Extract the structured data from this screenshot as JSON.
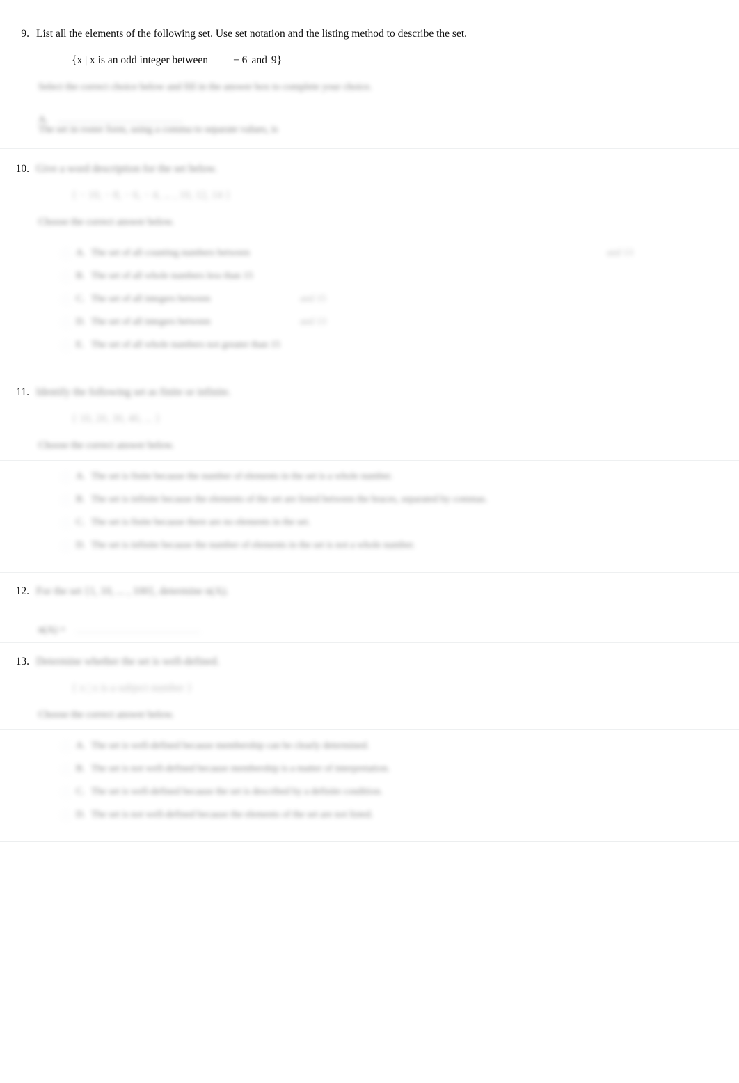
{
  "document": {
    "type": "math-worksheet",
    "page_background": "#ffffff",
    "divider_color": "#eef0f1",
    "questions": [
      {
        "number": "9.",
        "legible": true,
        "text": "List all the elements of the following set. Use set notation and the listing method to describe the set.",
        "set_expression_prefix": "{x | x is an odd integer between",
        "set_expression_value_a": "− 6",
        "set_expression_and": "and",
        "set_expression_value_b": "9",
        "set_expression_suffix": "}",
        "prompt": "Select the correct choice below and fill in the answer box to complete your choice.",
        "answer_label": "A.",
        "sub_prompt": "The set in roster form, using a comma to separate values, is",
        "blank": ""
      },
      {
        "number": "10.",
        "legible": false,
        "text": "Give a word description for the set below.",
        "set_expression": "{ − 10, − 8, − 6, − 4, ... , 10, 12, 14 }",
        "prompt": "Choose the correct answer below.",
        "choices": [
          {
            "letter": "A.",
            "text": "The set of all counting numbers between",
            "tail": "and 13"
          },
          {
            "letter": "B.",
            "text": "The set of all whole numbers less than 15"
          },
          {
            "letter": "C.",
            "text": "The set of all integers between",
            "tail": "and 15"
          },
          {
            "letter": "D.",
            "text": "The set of all integers between",
            "tail": "and 13"
          },
          {
            "letter": "E.",
            "text": "The set of all whole numbers not greater than 15"
          }
        ]
      },
      {
        "number": "11.",
        "legible": false,
        "text": "Identify the following set as finite or infinite.",
        "set_expression": "{ 10, 20, 30, 40, ... }",
        "prompt": "Choose the correct answer below.",
        "choices": [
          {
            "letter": "A.",
            "text": "The set is finite because the number of elements in the set is a whole number."
          },
          {
            "letter": "B.",
            "text": "The set is infinite because the elements of the set are listed between the braces, separated by commas."
          },
          {
            "letter": "C.",
            "text": "The set is finite because there are no elements in the set."
          },
          {
            "letter": "D.",
            "text": "The set is infinite because the number of elements in the set is not a whole number."
          }
        ]
      },
      {
        "number": "12.",
        "legible": false,
        "text": "For the set {1, 10, ... , 100}, determine n(A).",
        "answer_label": "n(A) =",
        "answer_value": ""
      },
      {
        "number": "13.",
        "legible": false,
        "text": "Determine whether the set is well-defined.",
        "set_expression": "{ x | x is a subject number }",
        "prompt": "Choose the correct answer below.",
        "choices": [
          {
            "letter": "A.",
            "text": "The set is well-defined because membership can be clearly determined."
          },
          {
            "letter": "B.",
            "text": "The set is not well-defined because membership is a matter of interpretation."
          },
          {
            "letter": "C.",
            "text": "The set is well-defined because the set is described by a definite condition."
          },
          {
            "letter": "D.",
            "text": "The set is not well-defined because the elements of the set are not listed."
          }
        ]
      }
    ]
  }
}
